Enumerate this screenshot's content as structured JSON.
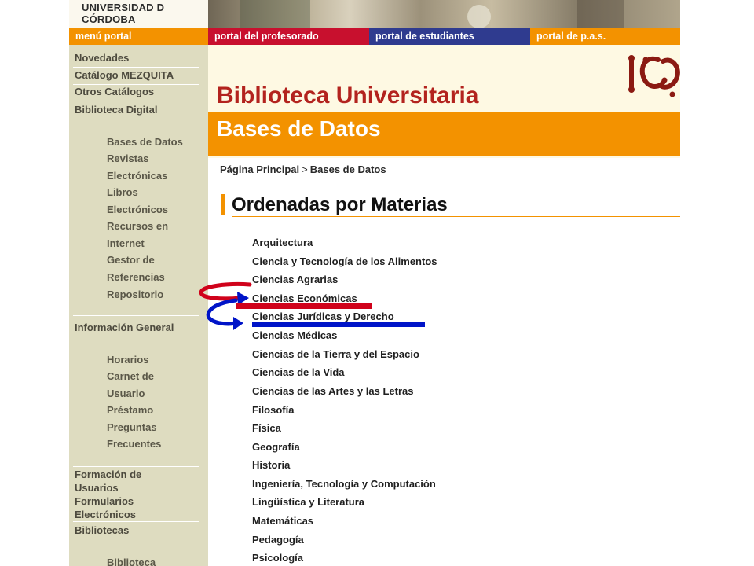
{
  "header": {
    "university_logo": "UNIVERSIDAD D CÓRDOBA",
    "brand_colors": {
      "orange": "#f39200",
      "red": "#c8102e",
      "blue": "#2f3b8f",
      "sidebar": "#dedcc0"
    }
  },
  "nav": {
    "tabs": [
      "menú portal",
      "portal del profesorado",
      "portal de estudiantes",
      "portal de p.a.s."
    ]
  },
  "sidebar": {
    "items": [
      "Novedades",
      "Catálogo MEZQUITA",
      "Otros Catálogos",
      "Biblioteca Digital"
    ],
    "digital_subitems": [
      "Bases de Datos",
      "Revistas",
      "Electrónicas",
      "Libros",
      "Electrónicos",
      "Recursos en",
      "Internet",
      "Gestor de",
      "Referencias",
      "Repositorio"
    ],
    "info_general": "Información General",
    "info_subitems": [
      "Horarios",
      "Carnet de",
      "Usuario",
      "Préstamo",
      "Preguntas",
      "Frecuentes"
    ],
    "formacion_line1": "Formación de",
    "formacion_line2": "Usuarios",
    "formularios_line1": "Formularios",
    "formularios_line2": "Electrónicos",
    "bibliotecas": "Bibliotecas",
    "biblioteca_sub": "Biblioteca"
  },
  "main": {
    "title": "Biblioteca Universitaria",
    "subtitle": "Bases de Datos",
    "breadcrumb": {
      "home": "Página Principal",
      "separator": ">",
      "current": "Bases de Datos"
    },
    "section_title": "Ordenadas por Materias",
    "materias": [
      "Arquitectura",
      "Ciencia y Tecnología de los Alimentos",
      "Ciencias Agrarias",
      "Ciencias Económicas",
      "Ciencias Jurídicas y Derecho",
      "Ciencias Médicas",
      "Ciencias de la Tierra y del Espacio",
      "Ciencias de la Vida",
      "Ciencias de las Artes y las Letras",
      "Filosofía",
      "Física",
      "Geografía",
      "Historia",
      "Ingeniería, Tecnología y Computación",
      "Lingüística y Literatura",
      "Matemáticas",
      "Pedagogía",
      "Psicología"
    ]
  },
  "annotations": {
    "red_arrow_color": "#d0021b",
    "blue_arrow_color": "#0014c8"
  }
}
